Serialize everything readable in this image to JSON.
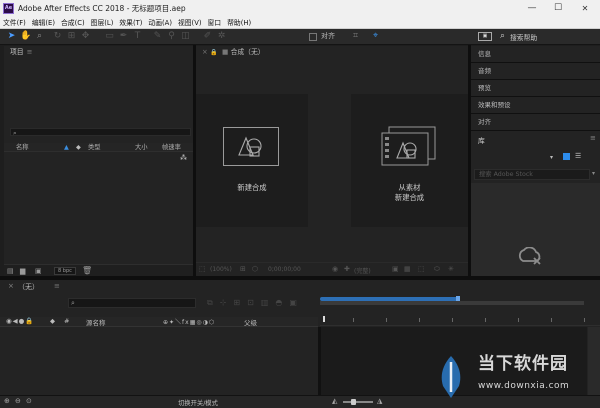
{
  "titlebar": {
    "title": "Adobe After Effects CC 2018 - 无标题项目.aep",
    "app_icon_text": "Ae",
    "minimize": "—",
    "maximize": "☐",
    "close": "✕"
  },
  "menu": [
    "文件(F)",
    "编辑(E)",
    "合成(C)",
    "图层(L)",
    "效果(T)",
    "动画(A)",
    "视图(V)",
    "窗口",
    "帮助(H)"
  ],
  "toolbar": {
    "snap_label": "对齐",
    "search_help_placeholder": "搜索帮助"
  },
  "project_panel": {
    "title": "项目",
    "search_icon": "⌕",
    "columns": [
      "名称",
      "类型",
      "大小",
      "帧速率"
    ],
    "bpc": "8 bpc"
  },
  "composition_panel": {
    "tab_label": "合成（无）",
    "new_comp_label": "新建合成",
    "from_footage_line1": "从素材",
    "from_footage_line2": "新建合成",
    "zoom": "(100%)",
    "timecode": "0;00;00;00",
    "resolution": "(完整)"
  },
  "right_panel": {
    "items": [
      "信息",
      "音频",
      "预览",
      "效果和预设",
      "对齐"
    ],
    "library_title": "库",
    "stock_search_placeholder": "搜索 Adobe Stock"
  },
  "timeline": {
    "tab_label": "（无）",
    "columns": [
      "源名称",
      "父级"
    ]
  },
  "status_bar": {
    "toggle_label": "切换开关/模式"
  },
  "watermark": {
    "brand": "当下软件园",
    "url": "www.downxia.com"
  }
}
